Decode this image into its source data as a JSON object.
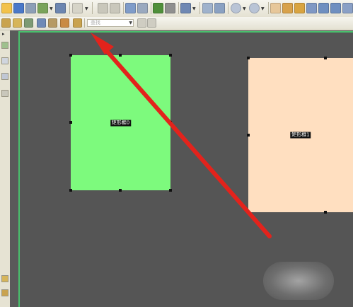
{
  "address_field": {
    "placeholder": "查找"
  },
  "objects": [
    {
      "label": "矩形框0",
      "fill": "#7dfa7d"
    },
    {
      "label": "矩形框1",
      "fill": "#ffdfc0"
    }
  ],
  "colors": {
    "canvas": "#555555",
    "arrow": "#e3231c",
    "canvas_border": "#49c06d"
  },
  "icons": {
    "toolbar_main": [
      "open-folder-icon",
      "save-icon",
      "print-icon",
      "email-icon",
      "tools-icon",
      "undo-disabled-icon",
      "back-icon",
      "forward-icon",
      "page-icon",
      "settings-icon",
      "undo-icon",
      "redo-icon",
      "zoom-icon",
      "fit-page-icon",
      "fit-width-icon",
      "zoom-out-icon",
      "zoom-in-icon",
      "hand-icon",
      "edit-icon",
      "pointer-icon",
      "text-icon",
      "form-icon"
    ],
    "toolbar_secondary": [
      "attach-icon",
      "comment-icon",
      "snapshot-icon",
      "image-icon",
      "link-icon",
      "stamp-icon",
      "sign-icon"
    ],
    "sidebar": [
      "pages-icon",
      "bookmarks-icon",
      "annotations-icon",
      "layers-icon",
      "attachments-icon"
    ]
  }
}
